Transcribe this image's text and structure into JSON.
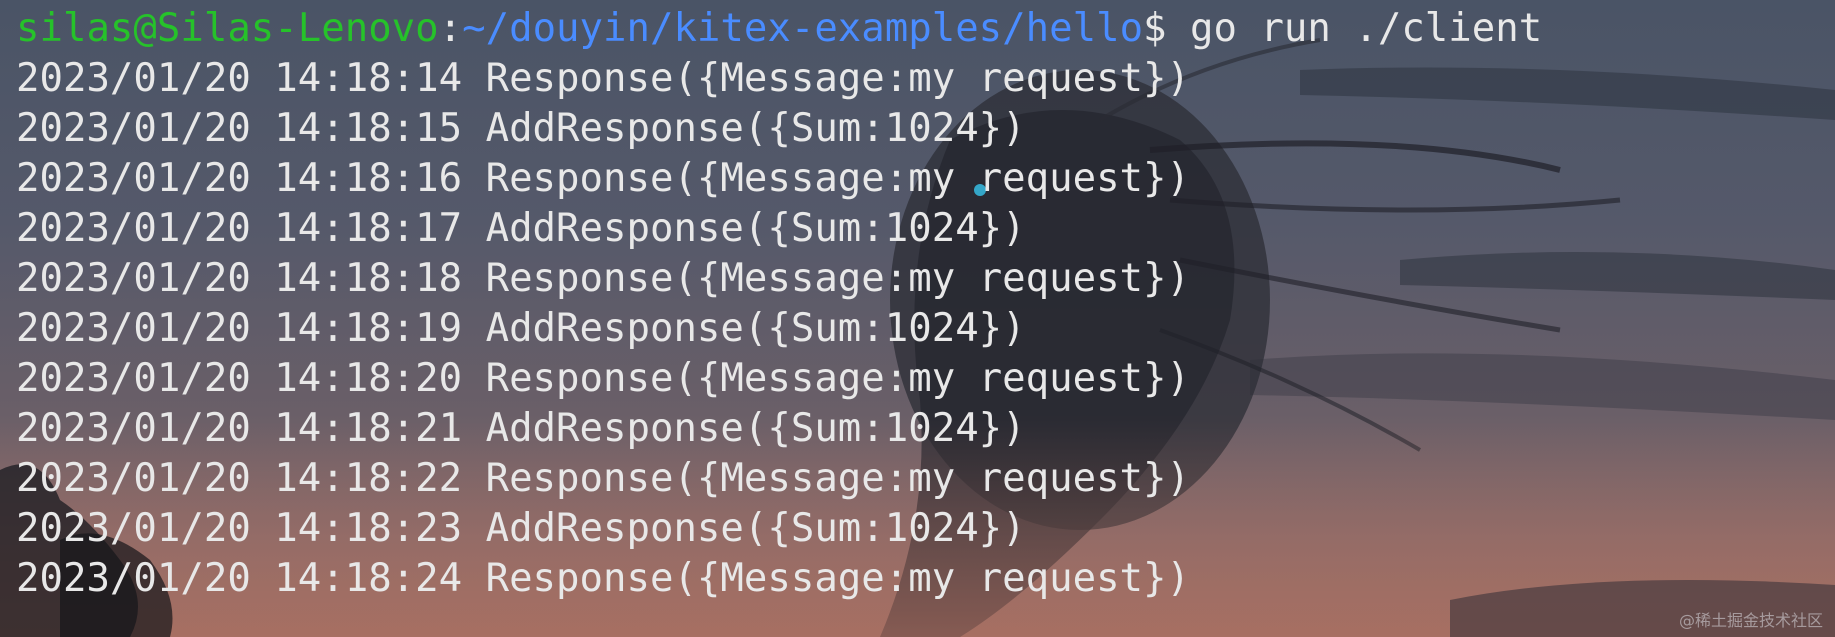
{
  "prompt": {
    "user_host": "silas@Silas-Lenovo",
    "separator": ":",
    "path": "~/douyin/kitex-examples/hello",
    "dollar": "$",
    "command": " go run ./client"
  },
  "output_lines": [
    "2023/01/20 14:18:14 Response({Message:my request})",
    "2023/01/20 14:18:15 AddResponse({Sum:1024})",
    "2023/01/20 14:18:16 Response({Message:my request})",
    "2023/01/20 14:18:17 AddResponse({Sum:1024})",
    "2023/01/20 14:18:18 Response({Message:my request})",
    "2023/01/20 14:18:19 AddResponse({Sum:1024})",
    "2023/01/20 14:18:20 Response({Message:my request})",
    "2023/01/20 14:18:21 AddResponse({Sum:1024})",
    "2023/01/20 14:18:22 Response({Message:my request})",
    "2023/01/20 14:18:23 AddResponse({Sum:1024})",
    "2023/01/20 14:18:24 Response({Message:my request})"
  ],
  "watermark": "@稀土掘金技术社区",
  "colors": {
    "prompt_user": "#26c22a",
    "prompt_path": "#4a8cff",
    "text": "#e8e8e8"
  }
}
